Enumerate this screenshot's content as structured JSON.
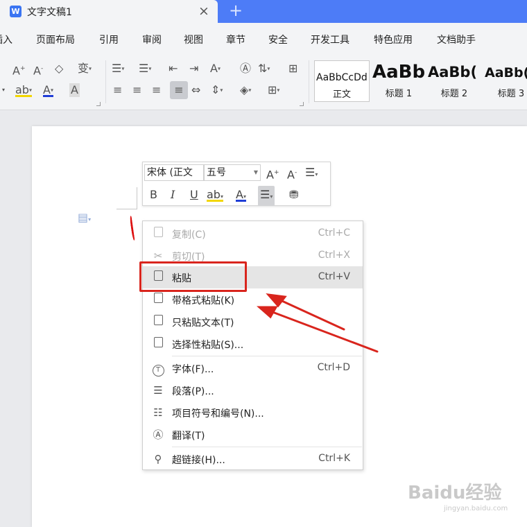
{
  "titlebar": {
    "app_icon": "W",
    "tab_title": "文字文稿1",
    "close_icon": "×",
    "add_icon": "+"
  },
  "menu": {
    "items": [
      "插入",
      "页面布局",
      "引用",
      "审阅",
      "视图",
      "章节",
      "安全",
      "开发工具",
      "特色应用",
      "文档助手"
    ]
  },
  "ribbon": {
    "styles": [
      {
        "sample": "AaBbCcDd",
        "name": "正文"
      },
      {
        "sample": "AaBb",
        "name": "标题 1"
      },
      {
        "sample": "AaBb(",
        "name": "标题 2"
      },
      {
        "sample": "AaBb(",
        "name": "标题 3"
      }
    ]
  },
  "mini_toolbar": {
    "font": "宋体 (正文",
    "size": "五号"
  },
  "context_menu": {
    "items": [
      {
        "label": "复制(C)",
        "shortcut": "Ctrl+C",
        "icon": "copy-icon",
        "disabled": true
      },
      {
        "label": "剪切(T)",
        "shortcut": "Ctrl+X",
        "icon": "scissors-icon",
        "disabled": true
      },
      {
        "label": "粘贴",
        "shortcut": "Ctrl+V",
        "icon": "paste-icon",
        "disabled": false
      },
      {
        "label": "带格式粘贴(K)",
        "shortcut": "",
        "icon": "paste-formatted-icon",
        "disabled": false
      },
      {
        "label": "只粘贴文本(T)",
        "shortcut": "",
        "icon": "paste-text-icon",
        "disabled": false
      },
      {
        "label": "选择性粘贴(S)...",
        "shortcut": "",
        "icon": "paste-special-icon",
        "disabled": false
      },
      {
        "label": "字体(F)...",
        "shortcut": "Ctrl+D",
        "icon": "font-icon",
        "disabled": false
      },
      {
        "label": "段落(P)...",
        "shortcut": "",
        "icon": "paragraph-icon",
        "disabled": false
      },
      {
        "label": "项目符号和编号(N)...",
        "shortcut": "",
        "icon": "list-icon",
        "disabled": false
      },
      {
        "label": "翻译(T)",
        "shortcut": "",
        "icon": "translate-icon",
        "disabled": false
      },
      {
        "label": "超链接(H)...",
        "shortcut": "Ctrl+K",
        "icon": "link-icon",
        "disabled": false
      }
    ]
  },
  "watermark": {
    "text": "Baidu经验",
    "url": "jingyan.baidu.com"
  },
  "colors": {
    "titlebar": "#4d7cf7",
    "annotation_red": "#d9251d",
    "highlight": "#e5e5e5"
  }
}
